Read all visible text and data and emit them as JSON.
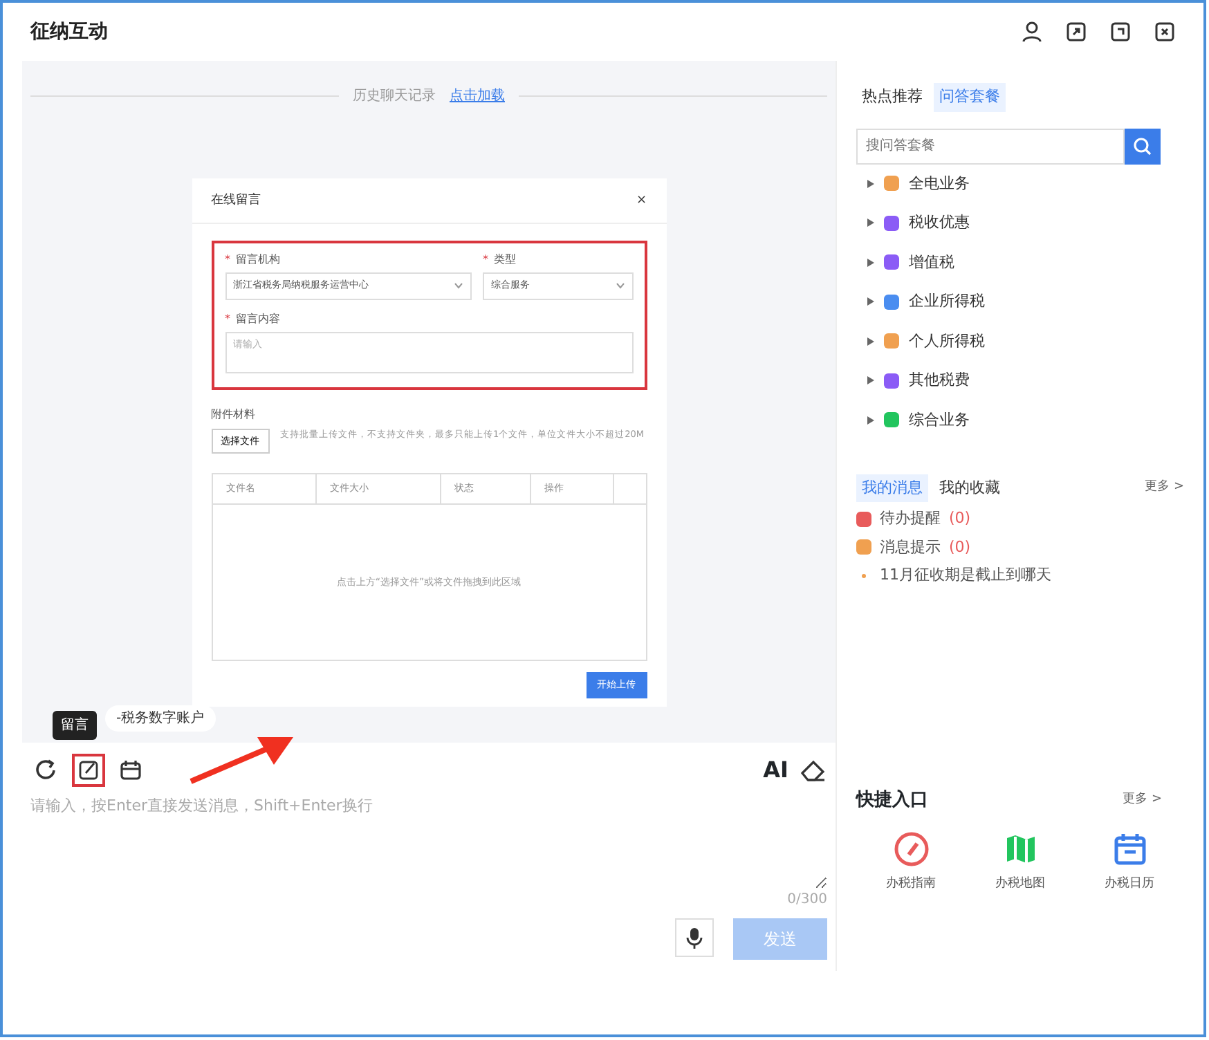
{
  "window": {
    "title": "征纳互动"
  },
  "required_mark": "*",
  "history": {
    "label": "历史聊天记录",
    "link": "点击加载"
  },
  "dialog": {
    "title": "在线留言",
    "close": "×",
    "fields": [
      {
        "label": "留言机构",
        "required": true,
        "value": "浙江省税务局纳税服务运营中心"
      },
      {
        "label": "类型",
        "required": true,
        "value": "综合服务"
      }
    ],
    "content": {
      "label": "留言内容",
      "required": true,
      "placeholder": "请输入"
    },
    "attach_label": "附件材料",
    "choose_button": "选择文件",
    "attach_hint": "支持批量上传文件，不支持文件夹，最多只能上传1个文件，单位文件大小不超过20M",
    "columns": [
      "文件名",
      "文件大小",
      "状态",
      "操作"
    ],
    "empty_text": "点击上方“选择文件”或将文件拖拽到此区域",
    "upload_button": "开始上传"
  },
  "account_pill": "-税务数字账户",
  "tooltip": "留言",
  "toolbar": [
    {
      "kind": "refresh",
      "highlighted": false
    },
    {
      "kind": "edit",
      "highlighted": true
    },
    {
      "kind": "calendar",
      "highlighted": false
    }
  ],
  "ai_label": "AI",
  "composer": {
    "placeholder": "请输入，按Enter直接发送消息，Shift+Enter换行",
    "counter": "0/300",
    "send": "发送",
    "send_disabled": true
  },
  "side_tabs": [
    {
      "label": "热点推荐",
      "selected": false
    },
    {
      "label": "问答套餐",
      "selected": true
    }
  ],
  "search": {
    "placeholder": "搜问答套餐"
  },
  "tree": [
    {
      "label": "全电业务",
      "color": "#f0a050"
    },
    {
      "label": "税收优惠",
      "color": "#8b5cf6"
    },
    {
      "label": "增值税",
      "color": "#8b5cf6"
    },
    {
      "label": "企业所得税",
      "color": "#4a8df0"
    },
    {
      "label": "个人所得税",
      "color": "#f0a050"
    },
    {
      "label": "其他税费",
      "color": "#8b5cf6"
    },
    {
      "label": "综合业务",
      "color": "#22c55e"
    }
  ],
  "msg_tabs": [
    {
      "label": "我的消息",
      "selected": true
    },
    {
      "label": "我的收藏",
      "selected": false
    }
  ],
  "msg_more": "更多 >",
  "messages": [
    {
      "kind": "todo",
      "label": "待办提醒",
      "count": "(0)",
      "color": "#e85b5b"
    },
    {
      "kind": "notice",
      "label": "消息提示",
      "count": "(0)",
      "color": "#f0a050"
    },
    {
      "kind": "faq",
      "label": "11月征收期是截止到哪天"
    }
  ],
  "quick": {
    "title": "快捷入口",
    "more": "更多 >",
    "items": [
      {
        "kind": "compass",
        "label": "办税指南"
      },
      {
        "kind": "map",
        "label": "办税地图"
      },
      {
        "kind": "calendar",
        "label": "办税日历"
      }
    ]
  }
}
